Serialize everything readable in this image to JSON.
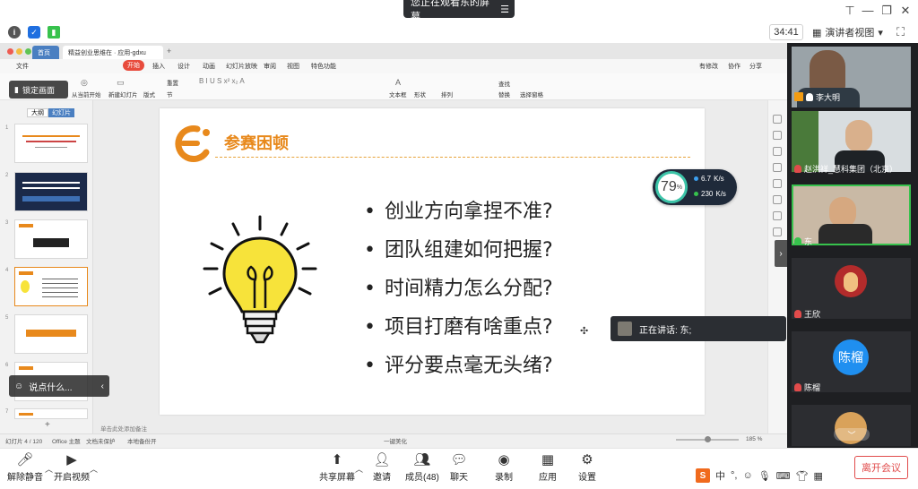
{
  "banner": {
    "text": "您正在观看东的屏幕",
    "menu_icon": "menu-icon"
  },
  "meeting": {
    "timer": "34:41",
    "view_label": "演讲者视图"
  },
  "browser": {
    "tabs": [
      {
        "label": "首页"
      },
      {
        "label": "精益创业思维在 · 应用-gdxu"
      }
    ]
  },
  "wps": {
    "menu": [
      "文件",
      "开始",
      "插入",
      "设计",
      "动画",
      "幻灯片放映",
      "审阅",
      "视图",
      "特色功能"
    ],
    "active_menu": "开始",
    "right_menu": [
      "有修改",
      "协作",
      "分享"
    ],
    "ribbon": [
      "从当前开始",
      "新建幻灯片",
      "版式",
      "节",
      "重置",
      "文本框",
      "形状",
      "排列",
      "替换",
      "选择窗格",
      "查找"
    ],
    "panel_tabs": [
      "大纲",
      "幻灯片"
    ],
    "lock_label": "锁定画面",
    "comment_label": "说点什么...",
    "notes_hint": "单击此处添加备注",
    "status_slide": "幻灯片 4 / 120",
    "status_theme": "Office 主题",
    "status_protect": "文档未保护",
    "status_backup": "本地备份开",
    "status_beautify": "一键美化",
    "zoom": "185 %",
    "thumb_numbers": [
      "1",
      "2",
      "3",
      "4",
      "5",
      "6",
      "7"
    ]
  },
  "slide": {
    "title": "参赛困顿",
    "bullets": [
      "创业方向拿捏不准?",
      "团队组建如何把握?",
      "时间精力怎么分配?",
      "项目打磨有啥重点?",
      "评分要点毫无头绪?"
    ]
  },
  "speed": {
    "percent": "79",
    "unit": "%",
    "up": "6.7",
    "up_unit": "K/s",
    "down": "230",
    "down_unit": "K/s"
  },
  "speaking": {
    "label": "正在讲话: 东;"
  },
  "participants": [
    {
      "name": "李大明"
    },
    {
      "name": "赵洪祥_慧科集团（北京）"
    },
    {
      "name": "东"
    },
    {
      "name": "王欣"
    },
    {
      "name": "陈榴",
      "avatar_text": "陈榴"
    }
  ],
  "controls": {
    "mute": "解除静音",
    "video": "开启视频",
    "share": "共享屏幕",
    "invite": "邀请",
    "members": "成员(48)",
    "chat": "聊天",
    "record": "录制",
    "apps": "应用",
    "settings": "设置",
    "leave": "离开会议"
  },
  "ime": {
    "logo": "S",
    "lang": "中"
  },
  "colors": {
    "accent_orange": "#e8891c",
    "leave_red": "#e14b4b",
    "wps_red": "#e84b3c",
    "avatar_blue": "#1f8ff0"
  }
}
